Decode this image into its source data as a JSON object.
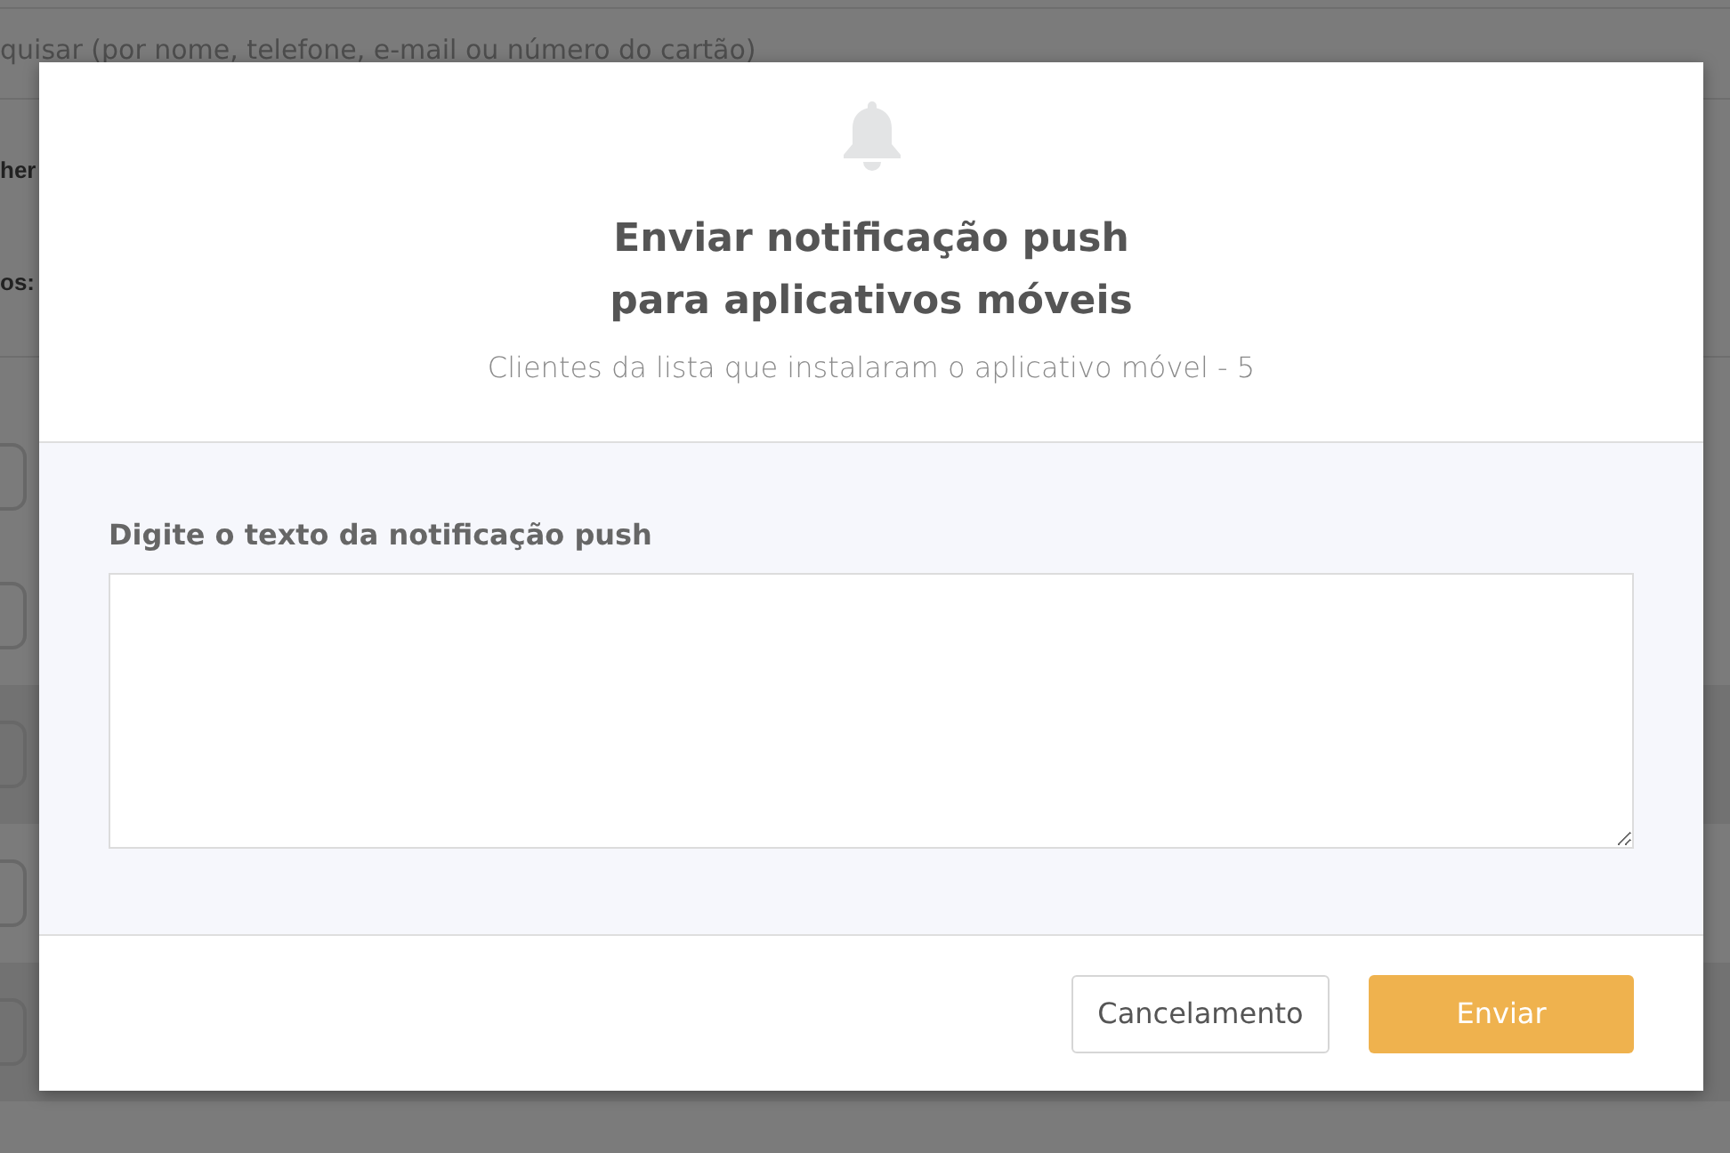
{
  "background": {
    "search_text": "quisar (por nome, telefone, e-mail ou número do cartão)",
    "labels": [
      "her",
      "os:"
    ],
    "rows": [
      {
        "checked": false
      },
      {
        "checked": false
      },
      {
        "checked": false
      },
      {
        "checked": false
      },
      {
        "checked": false
      }
    ]
  },
  "dialog": {
    "title_lines": [
      "Enviar notificação push",
      "para aplicativos móveis"
    ],
    "subtitle": "Clientes da lista que instalaram o aplicativo móvel - 5",
    "field": {
      "label": "Digite o texto da notificação push"
    },
    "buttons": [
      {
        "label": "Cancelamento",
        "kind": "secondary"
      },
      {
        "label": "Enviar",
        "kind": "primary"
      }
    ]
  }
}
